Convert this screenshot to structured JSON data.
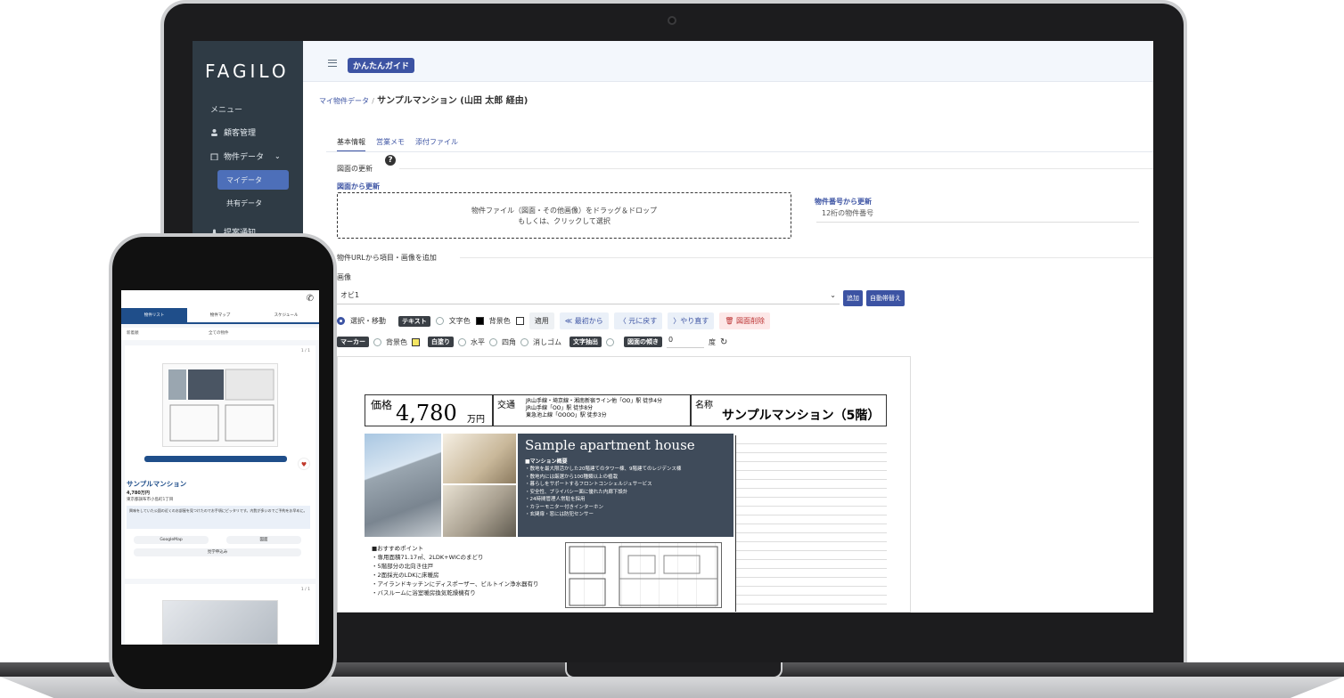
{
  "app": {
    "logo": "FAGILO",
    "guide_button": "かんたんガイド"
  },
  "sidebar": {
    "menu_title": "メニュー",
    "items": [
      {
        "label": "顧客管理"
      },
      {
        "label": "物件データ"
      },
      {
        "label": "提案通知"
      }
    ],
    "sub_items": [
      {
        "label": "マイデータ",
        "active": true
      },
      {
        "label": "共有データ",
        "active": false
      }
    ]
  },
  "breadcrumb": {
    "parent": "マイ物件データ",
    "separator": "/",
    "current": "サンプルマンション (山田 太郎 経由)"
  },
  "tabs": [
    "基本情報",
    "営業メモ",
    "添付ファイル"
  ],
  "form": {
    "floorplan_update_label": "図面の更新",
    "update_from_floorplan": "図面から更新",
    "dropzone_line1": "物件ファイル（図面・その他画像）をドラッグ＆ドロップ",
    "dropzone_line2": "もしくは、クリックして選択",
    "update_by_number_label": "物件番号から更新",
    "number_placeholder": "12桁の物件番号",
    "url_add_label": "物件URLから項目・画像を追加",
    "image_label": "画像",
    "image_select_value": "オビ1",
    "add_button": "追加",
    "auto_replace_button": "自動帯替え"
  },
  "toolbar": {
    "select_move": "選択・移動",
    "text_chip": "テキスト",
    "text_color": "文字色",
    "bg_color": "背景色",
    "apply": "適用",
    "first": "≪ 最初から",
    "undo": "〈 元に戻す",
    "redo": "〉やり直す",
    "delete_floorplan": "図面削除",
    "marker_chip": "マーカー",
    "bg_color2": "背景色",
    "fill_chip": "白塗り",
    "horizontal": "水平",
    "square": "四角",
    "eraser": "消しゴム",
    "text_extract_chip": "文字抽出",
    "tilt_chip": "図面の傾き",
    "tilt_value": "0",
    "degree": "度"
  },
  "sheet": {
    "price_label": "価格",
    "price_value": "4,780",
    "price_unit": "万円",
    "traffic_label": "交通",
    "traffic_lines": [
      "JR山手線・埼京線・湘南新宿ライン他「OO」駅 徒歩4分",
      "JR山手線「OO」駅 徒歩8分",
      "東急池上線「OOOO」駅 徒歩3分"
    ],
    "name_label": "名称",
    "name_value": "サンプルマンション（5階）",
    "concept_title": "Sample apartment house",
    "concept_sub": "■マンション概要",
    "concept_list": [
      "・敷地を最大限活かした20階建てのタワー棟、9階建てのレジデンス棟",
      "・敷地内には厳選から100種類以上の植栽",
      "・暮らしをサポートするフロントコンシェルジュサービス",
      "・安全性、プライバシー面に優れた内廊下設計",
      "・24時間管理人常駐を採用",
      "・カラーモニター付きインターホン",
      "・玄関扉・窓には防犯センサー"
    ],
    "points": [
      "■おすすめポイント",
      "・専用面積71.17㎡、2LDK+WICのまどり",
      "・5階部分の北向き住戸",
      "・2面採光のLDKに床暖房",
      "・アイランドキッチンにディスポーザー、ビルトイン浄水器有り",
      "・バスルームに浴室暖房換気乾燥機有り"
    ]
  },
  "phone": {
    "tabs": [
      "物件リスト",
      "物件マップ",
      "スケジュール"
    ],
    "filter_left": "新着順",
    "filter_right": "全ての物件",
    "page_indicator": "1 / 1",
    "name": "サンプルマンション",
    "price": "4,780万円",
    "address": "東京都調布市小島町1丁目",
    "message": "興味をしていた公園の近くのお部屋を見つけたのでお手頃にピッタリです。内覧が多いのでご予約をお早めに。",
    "map_button": "GoogleMap",
    "floorplan_button": "図面",
    "apply_button": "見学申込み",
    "page_indicator2": "1 / 1"
  }
}
